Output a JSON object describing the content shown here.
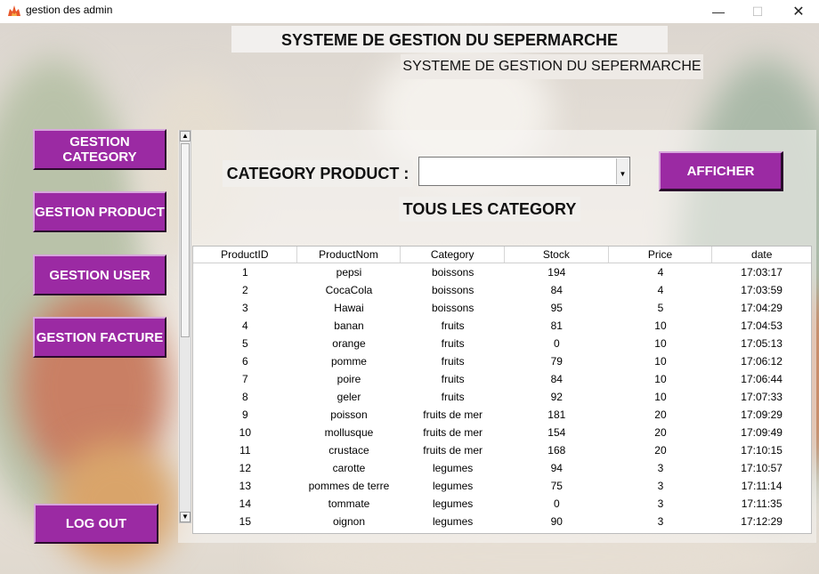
{
  "window": {
    "title": "gestion des admin",
    "icon": "flame-app-icon"
  },
  "header": {
    "title": "SYSTEME DE GESTION DU SEPERMARCHE",
    "subtitle": "SYSTEME DE GESTION DU SEPERMARCHE"
  },
  "sidebar": {
    "category": "GESTION CATEGORY",
    "product": "GESTION PRODUCT",
    "user": "GESTION USER",
    "facture": "GESTION FACTURE",
    "logout": "LOG OUT"
  },
  "filter": {
    "label": "CATEGORY PRODUCT :",
    "value": "",
    "button": "AFFICHER",
    "section_title": "TOUS LES CATEGORY"
  },
  "colors": {
    "button_bg": "#9b2aa3",
    "button_text": "#ffffff"
  },
  "table": {
    "columns": [
      "ProductID",
      "ProductNom",
      "Category",
      "Stock",
      "Price",
      "date"
    ],
    "rows": [
      [
        "1",
        "pepsi",
        "boissons",
        "194",
        "4",
        "17:03:17"
      ],
      [
        "2",
        "CocaCola",
        "boissons",
        "84",
        "4",
        "17:03:59"
      ],
      [
        "3",
        "Hawai",
        "boissons",
        "95",
        "5",
        "17:04:29"
      ],
      [
        "4",
        "banan",
        "fruits",
        "81",
        "10",
        "17:04:53"
      ],
      [
        "5",
        "orange",
        "fruits",
        "0",
        "10",
        "17:05:13"
      ],
      [
        "6",
        "pomme",
        "fruits",
        "79",
        "10",
        "17:06:12"
      ],
      [
        "7",
        "poire",
        "fruits",
        "84",
        "10",
        "17:06:44"
      ],
      [
        "8",
        "geler",
        "fruits",
        "92",
        "10",
        "17:07:33"
      ],
      [
        "9",
        "poisson",
        "fruits de mer",
        "181",
        "20",
        "17:09:29"
      ],
      [
        "10",
        "mollusque",
        "fruits de mer",
        "154",
        "20",
        "17:09:49"
      ],
      [
        "11",
        "crustace",
        "fruits de mer",
        "168",
        "20",
        "17:10:15"
      ],
      [
        "12",
        "carotte",
        "legumes",
        "94",
        "3",
        "17:10:57"
      ],
      [
        "13",
        "pommes de terre",
        "legumes",
        "75",
        "3",
        "17:11:14"
      ],
      [
        "14",
        "tommate",
        "legumes",
        "0",
        "3",
        "17:11:35"
      ],
      [
        "15",
        "oignon",
        "legumes",
        "90",
        "3",
        "17:12:29"
      ]
    ]
  }
}
